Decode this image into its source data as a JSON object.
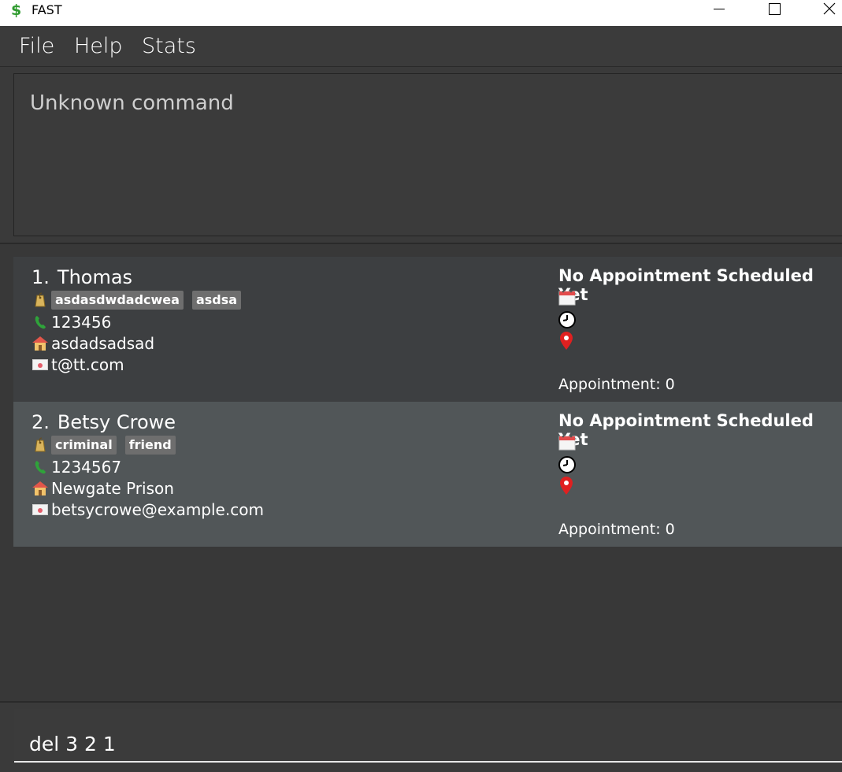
{
  "window": {
    "title": "FAST",
    "app_icon": "dollar-sign-icon"
  },
  "menu": {
    "file": "File",
    "help": "Help",
    "stats": "Stats"
  },
  "result": {
    "text": "Unknown command"
  },
  "persons": [
    {
      "index": "1.",
      "name": "Thomas",
      "tags": [
        "asdasdwdadcwea",
        "asdsa"
      ],
      "phone": "123456",
      "address": "asdadsadsad",
      "email": "t@tt.com",
      "appointment_title": "No Appointment Scheduled Yet",
      "appointment_count": "Appointment: 0"
    },
    {
      "index": "2.",
      "name": "Betsy Crowe",
      "tags": [
        "criminal",
        "friend"
      ],
      "phone": "1234567",
      "address": "Newgate Prison",
      "email": "betsycrowe@example.com",
      "appointment_title": "No Appointment Scheduled Yet",
      "appointment_count": "Appointment: 0"
    }
  ],
  "command": {
    "value": "del 3 2 1"
  },
  "colors": {
    "tag_bg": "#6e6e6e",
    "card_selected": "#515658",
    "pin_red": "#e02020",
    "phone_green": "#2fa33a"
  }
}
